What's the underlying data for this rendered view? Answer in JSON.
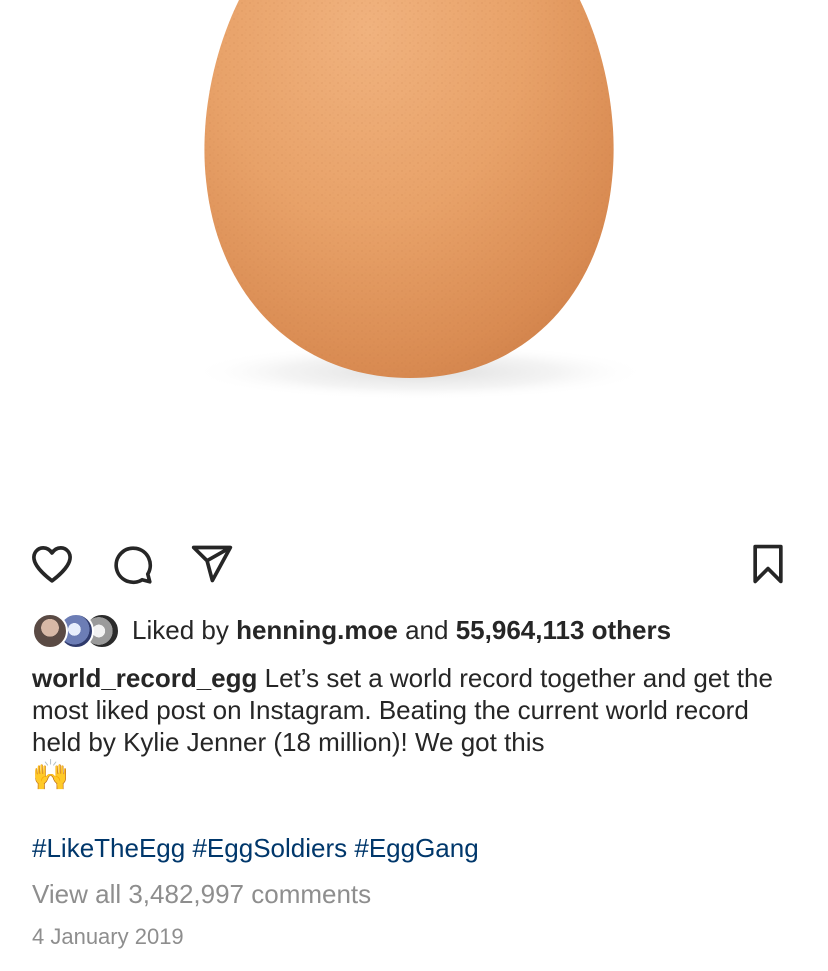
{
  "post": {
    "image_alt": "",
    "actions": {
      "like_icon": "heart-icon",
      "comment_icon": "comment-icon",
      "share_icon": "paper-plane-icon",
      "save_icon": "bookmark-icon"
    },
    "likes": {
      "prefix": "Liked by",
      "liker": "henning.moe",
      "joiner": "and",
      "others": "55,964,113 others"
    },
    "caption": {
      "username": "world_record_egg",
      "text": "Let’s set a world record together and get the most liked post on Instagram. Beating the current world record held by Kylie Jenner (18 million)! We got this",
      "emoji": "🙌"
    },
    "hashtags": [
      "#LikeTheEgg",
      "#EggSoldiers",
      "#EggGang"
    ],
    "view_comments": "View all 3,482,997 comments",
    "date": "4 January 2019",
    "colors": {
      "text": "#262626",
      "hashtag": "#00376b",
      "muted": "#8e8e8e",
      "egg": "#e6a26a"
    }
  }
}
